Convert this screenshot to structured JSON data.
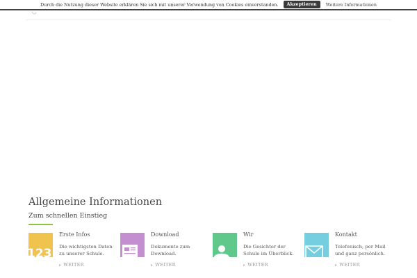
{
  "cookie_bar": {
    "message": "Durch die Nutzung dieser Website erklären Sie sich mit unserer Verwendung von Cookies einverstanden.",
    "accept_label": "Akzeptieren",
    "more_label": "Weitere Informationen"
  },
  "section": {
    "title": "Allgemeine Informationen",
    "subtitle": "Zum schnellen Einstieg",
    "accent_color": "#8cc63f"
  },
  "tiles": [
    {
      "title": "Erste Infos",
      "description": "Die wichtigsten Daten zu unserer Schule.",
      "link_label": "WEITER",
      "icon": "numbers-123-icon",
      "icon_text": "123",
      "color": "#f0c24e"
    },
    {
      "title": "Download",
      "description": "Dokumente zum Download.",
      "link_label": "WEITER",
      "icon": "document-icon",
      "color": "#c38fd0"
    },
    {
      "title": "Wir",
      "description": "Die Gesichter der Schule im Überblick.",
      "link_label": "WEITER",
      "icon": "person-icon",
      "color": "#5fc88a"
    },
    {
      "title": "Kontakt",
      "description": "Telefonisch, per Mail und ganz persönlich.",
      "link_label": "WEITER",
      "icon": "envelope-icon",
      "color": "#75cde0"
    }
  ]
}
